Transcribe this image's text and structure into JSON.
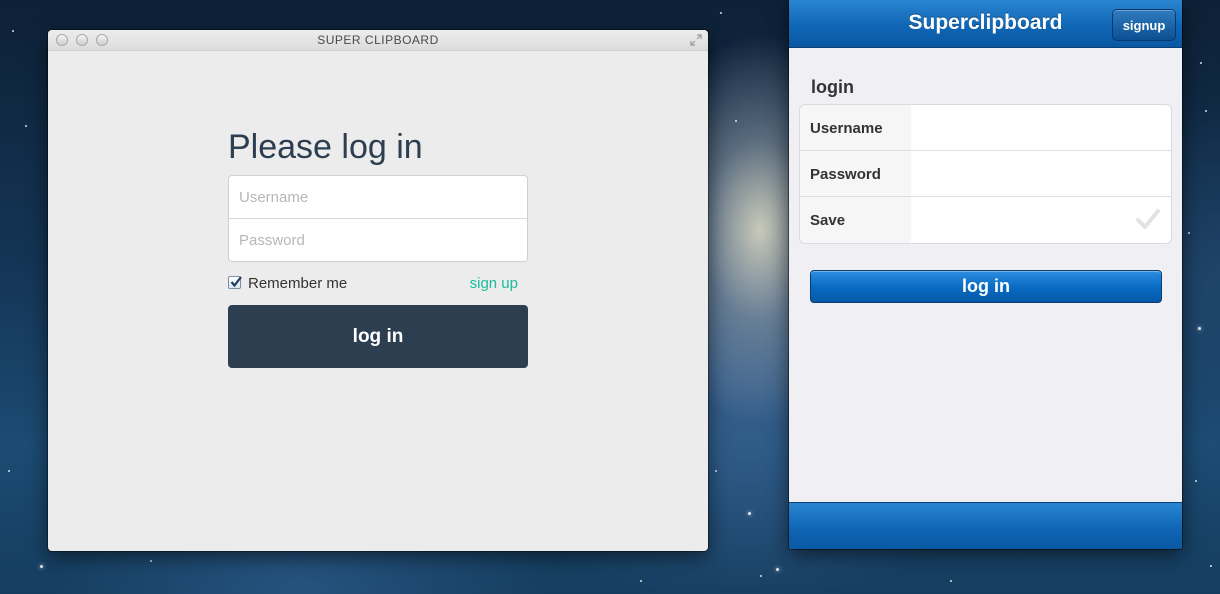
{
  "desktop_window": {
    "title": "SUPER CLIPBOARD",
    "heading": "Please log in",
    "username_placeholder": "Username",
    "password_placeholder": "Password",
    "remember_label": "Remember me",
    "remember_checked": true,
    "signup_link": "sign up",
    "login_button": "log in",
    "colors": {
      "primary": "#2c3e50",
      "link": "#1abc9c"
    }
  },
  "mobile_panel": {
    "title": "Superclipboard",
    "signup_button": "signup",
    "section_label": "login",
    "rows": [
      {
        "label": "Username",
        "value": ""
      },
      {
        "label": "Password",
        "value": ""
      },
      {
        "label": "Save",
        "icon": "checkmark-icon"
      }
    ],
    "login_button": "log in",
    "colors": {
      "header": "#0f66b5"
    }
  }
}
